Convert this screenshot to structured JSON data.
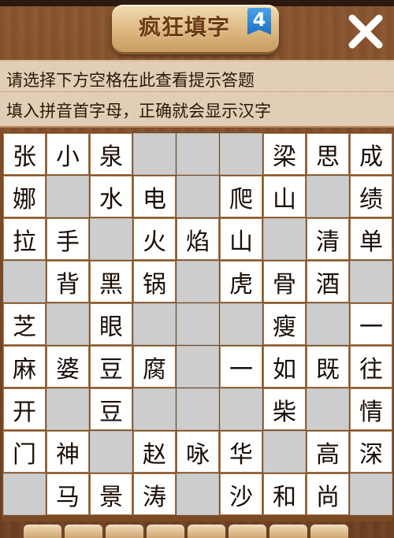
{
  "header": {
    "title": "疯狂填字",
    "level": "4",
    "close_icon": "close-icon"
  },
  "hints": {
    "line1": "请选择下方空格在此查看提示答题",
    "line2": "填入拼音首字母，正确就会显示汉字"
  },
  "colors": {
    "blank_cell": "#cdcdcd",
    "filled_cell": "#ffffff",
    "level_badge": "#2f86d6"
  },
  "grid": [
    [
      "张",
      "小",
      "泉",
      "",
      "",
      "",
      "梁",
      "思",
      "成"
    ],
    [
      "娜",
      "",
      "水",
      "电",
      "",
      "爬",
      "山",
      "",
      "绩"
    ],
    [
      "拉",
      "手",
      "",
      "火",
      "焰",
      "山",
      "",
      "清",
      "单"
    ],
    [
      "",
      "背",
      "黑",
      "锅",
      "",
      "虎",
      "骨",
      "酒",
      ""
    ],
    [
      "芝",
      "",
      "眼",
      "",
      "",
      "",
      "瘦",
      "",
      "一"
    ],
    [
      "麻",
      "婆",
      "豆",
      "腐",
      "",
      "一",
      "如",
      "既",
      "往"
    ],
    [
      "开",
      "",
      "豆",
      "",
      "",
      "",
      "柴",
      "",
      "情"
    ],
    [
      "门",
      "神",
      "",
      "赵",
      "咏",
      "华",
      "",
      "高",
      "深"
    ],
    [
      "",
      "马",
      "景",
      "涛",
      "",
      "沙",
      "和",
      "尚",
      ""
    ]
  ]
}
